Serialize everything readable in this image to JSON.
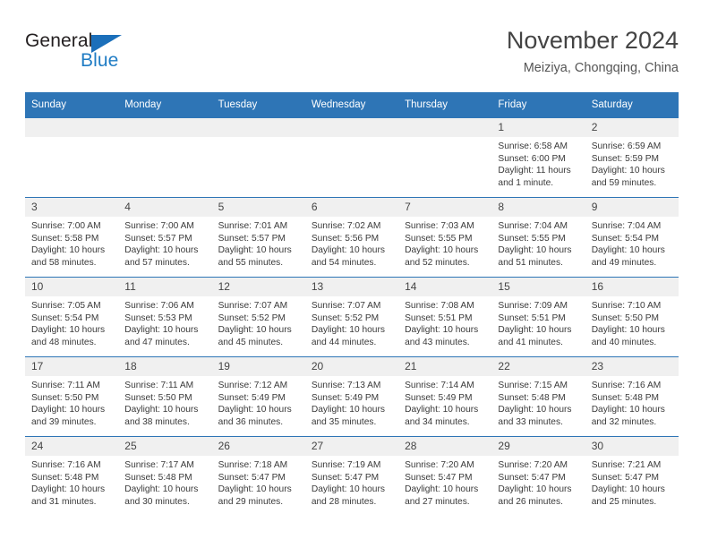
{
  "brand": {
    "name_top": "General",
    "name_bottom": "Blue",
    "accent_color": "#1b6fba"
  },
  "header": {
    "title": "November 2024",
    "subtitle": "Meiziya, Chongqing, China"
  },
  "calendar": {
    "header_bg": "#2e75b6",
    "daynum_bg": "#f0f0f0",
    "weekday_headers": [
      "Sunday",
      "Monday",
      "Tuesday",
      "Wednesday",
      "Thursday",
      "Friday",
      "Saturday"
    ],
    "weeks": [
      [
        {
          "day": "",
          "sunrise": "",
          "sunset": "",
          "daylight1": "",
          "daylight2": ""
        },
        {
          "day": "",
          "sunrise": "",
          "sunset": "",
          "daylight1": "",
          "daylight2": ""
        },
        {
          "day": "",
          "sunrise": "",
          "sunset": "",
          "daylight1": "",
          "daylight2": ""
        },
        {
          "day": "",
          "sunrise": "",
          "sunset": "",
          "daylight1": "",
          "daylight2": ""
        },
        {
          "day": "",
          "sunrise": "",
          "sunset": "",
          "daylight1": "",
          "daylight2": ""
        },
        {
          "day": "1",
          "sunrise": "Sunrise: 6:58 AM",
          "sunset": "Sunset: 6:00 PM",
          "daylight1": "Daylight: 11 hours",
          "daylight2": "and 1 minute."
        },
        {
          "day": "2",
          "sunrise": "Sunrise: 6:59 AM",
          "sunset": "Sunset: 5:59 PM",
          "daylight1": "Daylight: 10 hours",
          "daylight2": "and 59 minutes."
        }
      ],
      [
        {
          "day": "3",
          "sunrise": "Sunrise: 7:00 AM",
          "sunset": "Sunset: 5:58 PM",
          "daylight1": "Daylight: 10 hours",
          "daylight2": "and 58 minutes."
        },
        {
          "day": "4",
          "sunrise": "Sunrise: 7:00 AM",
          "sunset": "Sunset: 5:57 PM",
          "daylight1": "Daylight: 10 hours",
          "daylight2": "and 57 minutes."
        },
        {
          "day": "5",
          "sunrise": "Sunrise: 7:01 AM",
          "sunset": "Sunset: 5:57 PM",
          "daylight1": "Daylight: 10 hours",
          "daylight2": "and 55 minutes."
        },
        {
          "day": "6",
          "sunrise": "Sunrise: 7:02 AM",
          "sunset": "Sunset: 5:56 PM",
          "daylight1": "Daylight: 10 hours",
          "daylight2": "and 54 minutes."
        },
        {
          "day": "7",
          "sunrise": "Sunrise: 7:03 AM",
          "sunset": "Sunset: 5:55 PM",
          "daylight1": "Daylight: 10 hours",
          "daylight2": "and 52 minutes."
        },
        {
          "day": "8",
          "sunrise": "Sunrise: 7:04 AM",
          "sunset": "Sunset: 5:55 PM",
          "daylight1": "Daylight: 10 hours",
          "daylight2": "and 51 minutes."
        },
        {
          "day": "9",
          "sunrise": "Sunrise: 7:04 AM",
          "sunset": "Sunset: 5:54 PM",
          "daylight1": "Daylight: 10 hours",
          "daylight2": "and 49 minutes."
        }
      ],
      [
        {
          "day": "10",
          "sunrise": "Sunrise: 7:05 AM",
          "sunset": "Sunset: 5:54 PM",
          "daylight1": "Daylight: 10 hours",
          "daylight2": "and 48 minutes."
        },
        {
          "day": "11",
          "sunrise": "Sunrise: 7:06 AM",
          "sunset": "Sunset: 5:53 PM",
          "daylight1": "Daylight: 10 hours",
          "daylight2": "and 47 minutes."
        },
        {
          "day": "12",
          "sunrise": "Sunrise: 7:07 AM",
          "sunset": "Sunset: 5:52 PM",
          "daylight1": "Daylight: 10 hours",
          "daylight2": "and 45 minutes."
        },
        {
          "day": "13",
          "sunrise": "Sunrise: 7:07 AM",
          "sunset": "Sunset: 5:52 PM",
          "daylight1": "Daylight: 10 hours",
          "daylight2": "and 44 minutes."
        },
        {
          "day": "14",
          "sunrise": "Sunrise: 7:08 AM",
          "sunset": "Sunset: 5:51 PM",
          "daylight1": "Daylight: 10 hours",
          "daylight2": "and 43 minutes."
        },
        {
          "day": "15",
          "sunrise": "Sunrise: 7:09 AM",
          "sunset": "Sunset: 5:51 PM",
          "daylight1": "Daylight: 10 hours",
          "daylight2": "and 41 minutes."
        },
        {
          "day": "16",
          "sunrise": "Sunrise: 7:10 AM",
          "sunset": "Sunset: 5:50 PM",
          "daylight1": "Daylight: 10 hours",
          "daylight2": "and 40 minutes."
        }
      ],
      [
        {
          "day": "17",
          "sunrise": "Sunrise: 7:11 AM",
          "sunset": "Sunset: 5:50 PM",
          "daylight1": "Daylight: 10 hours",
          "daylight2": "and 39 minutes."
        },
        {
          "day": "18",
          "sunrise": "Sunrise: 7:11 AM",
          "sunset": "Sunset: 5:50 PM",
          "daylight1": "Daylight: 10 hours",
          "daylight2": "and 38 minutes."
        },
        {
          "day": "19",
          "sunrise": "Sunrise: 7:12 AM",
          "sunset": "Sunset: 5:49 PM",
          "daylight1": "Daylight: 10 hours",
          "daylight2": "and 36 minutes."
        },
        {
          "day": "20",
          "sunrise": "Sunrise: 7:13 AM",
          "sunset": "Sunset: 5:49 PM",
          "daylight1": "Daylight: 10 hours",
          "daylight2": "and 35 minutes."
        },
        {
          "day": "21",
          "sunrise": "Sunrise: 7:14 AM",
          "sunset": "Sunset: 5:49 PM",
          "daylight1": "Daylight: 10 hours",
          "daylight2": "and 34 minutes."
        },
        {
          "day": "22",
          "sunrise": "Sunrise: 7:15 AM",
          "sunset": "Sunset: 5:48 PM",
          "daylight1": "Daylight: 10 hours",
          "daylight2": "and 33 minutes."
        },
        {
          "day": "23",
          "sunrise": "Sunrise: 7:16 AM",
          "sunset": "Sunset: 5:48 PM",
          "daylight1": "Daylight: 10 hours",
          "daylight2": "and 32 minutes."
        }
      ],
      [
        {
          "day": "24",
          "sunrise": "Sunrise: 7:16 AM",
          "sunset": "Sunset: 5:48 PM",
          "daylight1": "Daylight: 10 hours",
          "daylight2": "and 31 minutes."
        },
        {
          "day": "25",
          "sunrise": "Sunrise: 7:17 AM",
          "sunset": "Sunset: 5:48 PM",
          "daylight1": "Daylight: 10 hours",
          "daylight2": "and 30 minutes."
        },
        {
          "day": "26",
          "sunrise": "Sunrise: 7:18 AM",
          "sunset": "Sunset: 5:47 PM",
          "daylight1": "Daylight: 10 hours",
          "daylight2": "and 29 minutes."
        },
        {
          "day": "27",
          "sunrise": "Sunrise: 7:19 AM",
          "sunset": "Sunset: 5:47 PM",
          "daylight1": "Daylight: 10 hours",
          "daylight2": "and 28 minutes."
        },
        {
          "day": "28",
          "sunrise": "Sunrise: 7:20 AM",
          "sunset": "Sunset: 5:47 PM",
          "daylight1": "Daylight: 10 hours",
          "daylight2": "and 27 minutes."
        },
        {
          "day": "29",
          "sunrise": "Sunrise: 7:20 AM",
          "sunset": "Sunset: 5:47 PM",
          "daylight1": "Daylight: 10 hours",
          "daylight2": "and 26 minutes."
        },
        {
          "day": "30",
          "sunrise": "Sunrise: 7:21 AM",
          "sunset": "Sunset: 5:47 PM",
          "daylight1": "Daylight: 10 hours",
          "daylight2": "and 25 minutes."
        }
      ]
    ]
  }
}
